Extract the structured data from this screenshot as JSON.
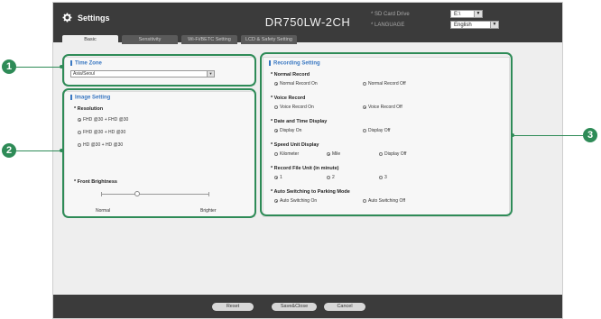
{
  "header": {
    "title": "Settings",
    "model": "DR750LW-2CH",
    "sd_card_label": "* SD Card Drive",
    "sd_card_value": "E:\\",
    "language_label": "* LANGUAGE",
    "language_value": "English",
    "arrow": "▼"
  },
  "tabs": [
    {
      "label": "Basic"
    },
    {
      "label": "Sensitivity"
    },
    {
      "label": "Wi-Fi/BETC Setting"
    },
    {
      "label": "LCD & Safety Setting"
    }
  ],
  "time_zone": {
    "title": "Time Zone",
    "value": "Asia/Seoul"
  },
  "image_setting": {
    "title": "Image Setting",
    "resolution_label": "* Resolution",
    "resolution_options": [
      "FHD @30 + FHD @30",
      "FHD @30 + HD @30",
      "HD @30 + HD @30"
    ],
    "resolution_selected": 0,
    "brightness_label": "* Front Brightness",
    "brightness_min": "Normal",
    "brightness_max": "Brighter",
    "brightness_level": 0.33
  },
  "recording": {
    "title": "Recording Setting",
    "normal_record": {
      "label": "* Normal Record",
      "options": [
        "Normal Record On",
        "Normal Record Off"
      ],
      "selected": 0
    },
    "voice_record": {
      "label": "* Voice Record",
      "options": [
        "Voice Record On",
        "Voice Record Off"
      ],
      "selected": 1
    },
    "date_time": {
      "label": "* Date and Time Display",
      "options": [
        "Display On",
        "Display Off"
      ],
      "selected": 0
    },
    "speed_unit": {
      "label": "* Speed Unit Display",
      "options": [
        "Kilometer",
        "Mile",
        "Display Off"
      ],
      "selected": 1
    },
    "record_file": {
      "label": "* Record File Unit (in minute)",
      "options": [
        "1",
        "2",
        "3"
      ],
      "selected": 0
    },
    "parking": {
      "label": "* Auto Switching to Parking Mode",
      "options": [
        "Auto Switching On",
        "Auto Switching Off"
      ],
      "selected": 0
    }
  },
  "footer": {
    "reset": "Reset",
    "save_close": "Save&Close",
    "cancel": "Cancel"
  },
  "callouts": [
    "1",
    "2",
    "3"
  ],
  "colors": {
    "accent": "#3a78c2",
    "callout": "#2e8b57",
    "header": "#3b3b3b"
  }
}
